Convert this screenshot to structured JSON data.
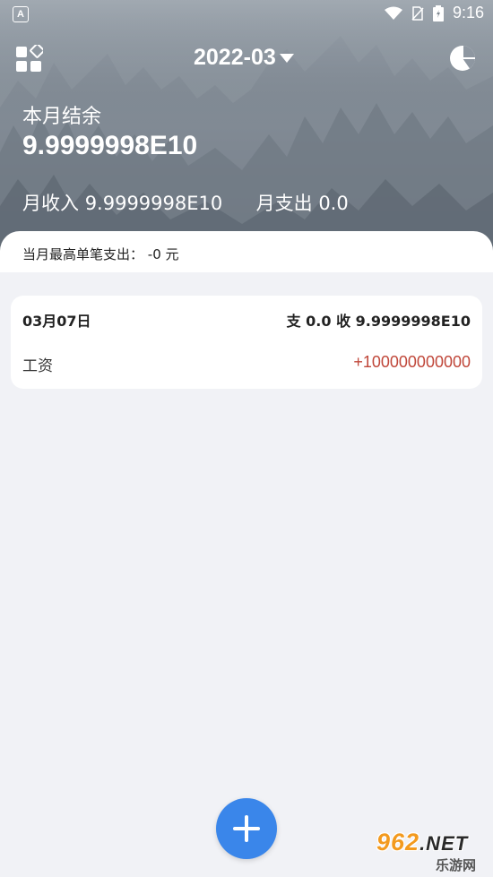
{
  "status_bar": {
    "left_badge": "A",
    "time": "9:16"
  },
  "header": {
    "month": "2022-03",
    "balance_label": "本月结余",
    "balance_value": "9.9999998E10",
    "income_label": "月收入",
    "income_value": "9.9999998E10",
    "expense_label": "月支出",
    "expense_value": "0.0"
  },
  "info_bar": {
    "max_expense_label": "当月最高单笔支出：",
    "max_expense_value": "-0 元"
  },
  "days": [
    {
      "date": "03月07日",
      "totals": "支 0.0 收 9.9999998E10",
      "entries": [
        {
          "name": "工资",
          "amount": "+100000000000"
        }
      ]
    }
  ],
  "icons": {
    "apps": "apps-grid-icon",
    "dropdown": "caret-down-icon",
    "stats": "pie-chart-icon",
    "add": "plus-icon"
  },
  "colors": {
    "income": "#c0473a",
    "fab": "#3a86ea",
    "background": "#f1f2f6"
  },
  "watermark": {
    "brand": "962",
    "domain": ".NET",
    "subtitle": "乐游网"
  }
}
